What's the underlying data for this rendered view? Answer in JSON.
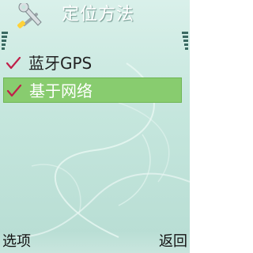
{
  "header": {
    "title": "定位方法",
    "icon": "wrench-screwdriver-icon"
  },
  "list": {
    "items": [
      {
        "label": "蓝牙GPS",
        "checked": true,
        "selected": false
      },
      {
        "label": "基于网络",
        "checked": true,
        "selected": true
      }
    ]
  },
  "softkeys": {
    "left_label": "选项",
    "right_label": "返回"
  },
  "colors": {
    "accent": "#88cc6f",
    "check": "#c0204a",
    "background": "#c5e6dd"
  }
}
